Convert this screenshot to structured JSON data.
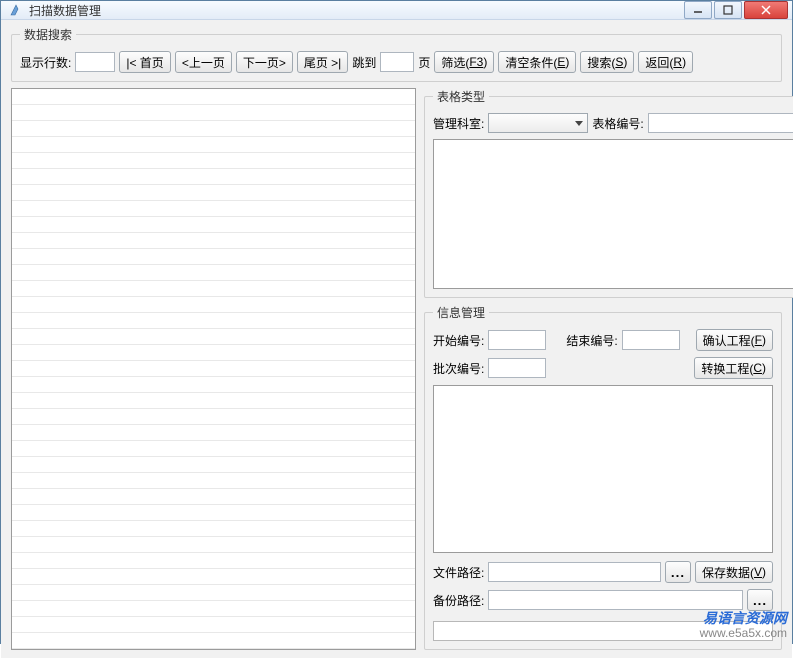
{
  "window": {
    "title": "扫描数据管理"
  },
  "search": {
    "legend": "数据搜索",
    "rows_label": "显示行数:",
    "rows_value": "",
    "first_btn": "|< 首页",
    "prev_btn": "<上一页",
    "next_btn": "下一页>",
    "last_btn": "尾页 >|",
    "jump_label": "跳到",
    "jump_value": "",
    "page_suffix": "页",
    "filter_btn": "筛选(",
    "filter_key": "F3",
    "filter_btn2": ")",
    "clear_btn": "清空条件(",
    "clear_key": "E",
    "clear_btn2": ")",
    "search_btn": "搜索(",
    "search_key": "S",
    "search_btn2": ")",
    "back_btn": "返回(",
    "back_key": "R",
    "back_btn2": ")"
  },
  "table_type": {
    "legend": "表格类型",
    "dept_label": "管理科室:",
    "table_no_label": "表格编号:",
    "table_no_value": ""
  },
  "info_mgmt": {
    "legend": "信息管理",
    "start_no_label": "开始编号:",
    "start_no_value": "",
    "end_no_label": "结束编号:",
    "end_no_value": "",
    "confirm_btn": "确认工程(",
    "confirm_key": "F",
    "confirm_btn2": ")",
    "batch_no_label": "批次编号:",
    "batch_no_value": "",
    "convert_btn": "转换工程(",
    "convert_key": "C",
    "convert_btn2": ")",
    "file_path_label": "文件路径:",
    "file_path_value": "",
    "browse_label": "...",
    "save_btn": "保存数据(",
    "save_key": "V",
    "save_btn2": ")",
    "backup_path_label": "备份路径:",
    "backup_path_value": ""
  },
  "watermark": {
    "cn": "易语言资源网",
    "url": "www.e5a5x.com"
  }
}
